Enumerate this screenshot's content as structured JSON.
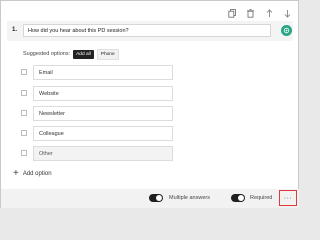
{
  "toolbar": {
    "icons": [
      "copy-icon",
      "delete-icon",
      "move-up-icon",
      "move-down-icon"
    ]
  },
  "question": {
    "number": "1.",
    "text": "How did you hear about this PD session?",
    "avatar_color": "#2aa586"
  },
  "suggestions": {
    "label": "Suggested options:",
    "chips": [
      "Add all",
      "Phone"
    ]
  },
  "options": [
    "Email",
    "Website",
    "Newsletter",
    "Colleague",
    "Other"
  ],
  "add_option": {
    "label": "Add option"
  },
  "footer": {
    "multiple_answers_label": "Multiple answers",
    "required_label": "Required",
    "more_label": "···",
    "multiple_answers_on": true,
    "required_on": true
  },
  "colors": {
    "highlight": "#e03a3a",
    "toggle_on": "#1f1f1f"
  }
}
